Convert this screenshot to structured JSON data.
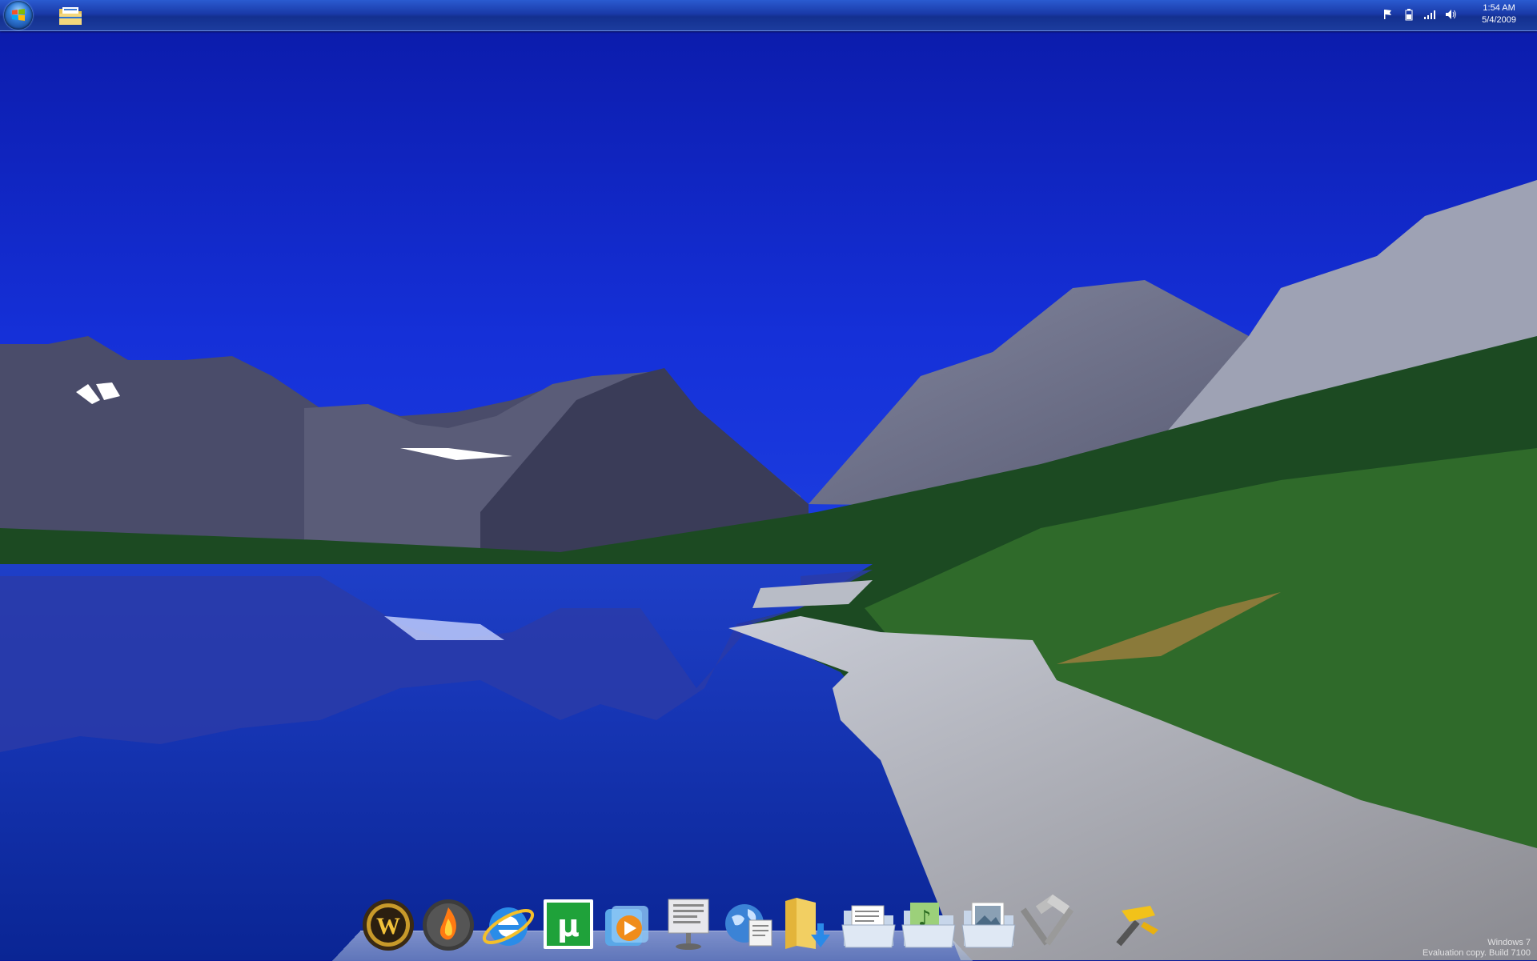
{
  "taskbar": {
    "start_icon": "windows-orb-icon",
    "pinned": [
      {
        "icon": "folder-explorer-icon"
      }
    ],
    "tray_icons": [
      "action-center-flag-icon",
      "battery-icon",
      "network-signal-icon",
      "volume-icon"
    ],
    "clock": {
      "time": "1:54 AM",
      "date": "5/4/2009"
    }
  },
  "dock": {
    "items": [
      {
        "icon": "world-of-warcraft-icon"
      },
      {
        "icon": "flame-app-icon"
      },
      {
        "icon": "internet-explorer-icon"
      },
      {
        "icon": "utorrent-icon"
      },
      {
        "icon": "media-player-icon"
      },
      {
        "icon": "document-display-icon"
      },
      {
        "icon": "globe-document-icon"
      },
      {
        "icon": "downloads-folder-icon"
      },
      {
        "icon": "documents-folder-icon"
      },
      {
        "icon": "music-folder-icon"
      },
      {
        "icon": "pictures-folder-icon"
      },
      {
        "icon": "tools-icon"
      },
      {
        "icon": "hammer-tool-icon"
      }
    ]
  },
  "watermark": {
    "line1": "Windows 7",
    "line2": "Evaluation copy. Build 7100"
  },
  "colors": {
    "sky": "#0a1fb8",
    "water": "#0b2aa0",
    "taskbar": "#1a3aa8"
  }
}
